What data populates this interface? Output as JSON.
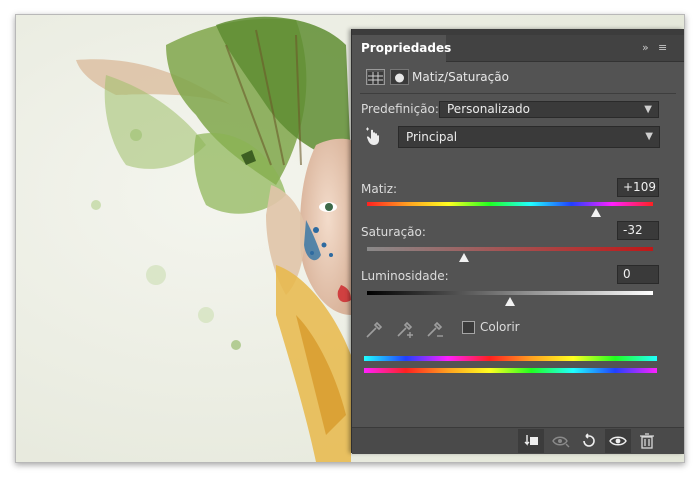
{
  "panel": {
    "tab_label": "Propriedades",
    "expand_glyph": "»",
    "menu_glyph": "≡",
    "adjustment_title": "Matiz/Saturação",
    "preset_label": "Predefinição:",
    "preset_value": "Personalizado",
    "channel_value": "Principal",
    "hue": {
      "label": "Matiz:",
      "value": "+109",
      "level": 0.8
    },
    "saturation": {
      "label": "Saturação:",
      "value": "-32",
      "level": 0.34
    },
    "lightness": {
      "label": "Luminosidade:",
      "value": "0",
      "level": 0.5
    },
    "colorize_label": "Colorir",
    "colorize_checked": false
  },
  "icons": {
    "header": [
      "adjustment-layer-icon",
      "mask-icon"
    ],
    "tools": [
      "hand-target-icon",
      "eyedropper-icon",
      "eyedropper-plus-icon",
      "eyedropper-minus-icon"
    ],
    "footer": [
      "clip-to-layer-icon",
      "view-previous-state-icon",
      "reset-icon",
      "visibility-eye-icon",
      "trash-icon"
    ]
  },
  "colors": {
    "panel_bg": "#535353",
    "field_bg": "#3a3a3a",
    "tab_bar": "#424242"
  }
}
